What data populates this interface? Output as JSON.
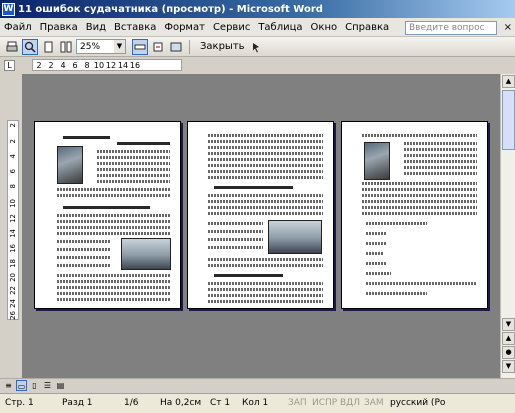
{
  "window": {
    "title": "11 ошибок судачатника (просмотр) - Microsoft Word",
    "app_icon": "W"
  },
  "menu": {
    "items": [
      "Файл",
      "Правка",
      "Вид",
      "Вставка",
      "Формат",
      "Сервис",
      "Таблица",
      "Окно",
      "Справка"
    ],
    "help_placeholder": "Введите вопрос",
    "close_glyph": "×"
  },
  "toolbar": {
    "zoom": "25%",
    "close_label": "Закрыть"
  },
  "ruler": {
    "corner": "L",
    "marks": [
      "2",
      "2",
      "4",
      "6",
      "8",
      "10",
      "12",
      "14",
      "16"
    ]
  },
  "vruler": {
    "marks": [
      "2",
      "2",
      "4",
      "6",
      "8",
      "10",
      "12",
      "14",
      "16",
      "18",
      "20",
      "22",
      "24",
      "26"
    ]
  },
  "statusbar": {
    "page": "Стр. 1",
    "section": "Разд 1",
    "pages": "1/6",
    "position": "На 0,2см",
    "line": "Ст 1",
    "column": "Кол 1",
    "rec": "ЗАП",
    "trk": "ИСПР",
    "ext": "ВДЛ",
    "ovr": "ЗАМ",
    "language": "русский (Ро"
  },
  "colors": {
    "title_bar": "#0a246a",
    "workspace": "#808080",
    "accent": "#316ac5"
  }
}
